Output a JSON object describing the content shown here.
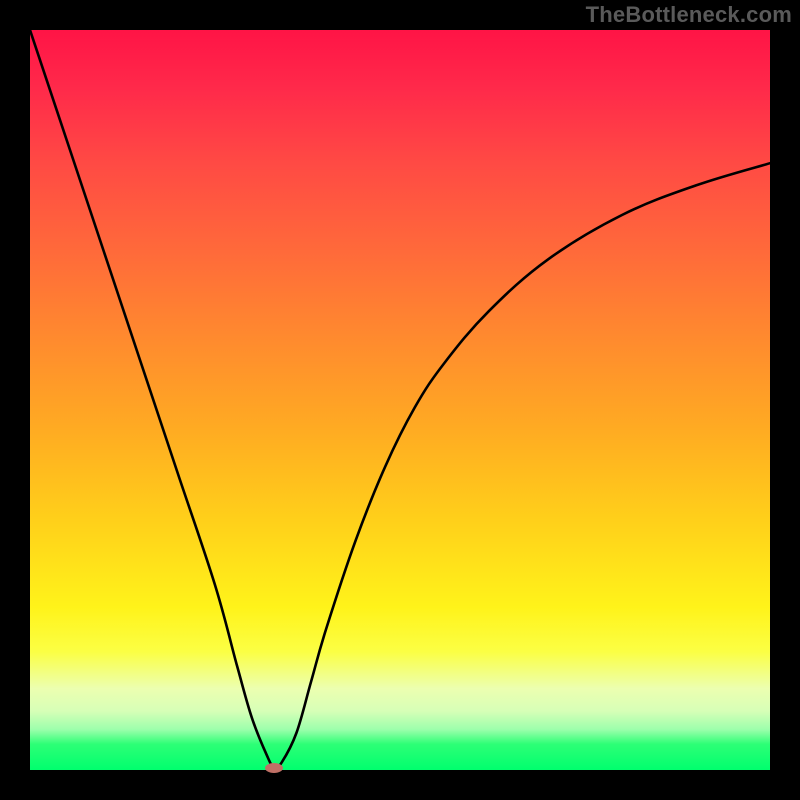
{
  "watermark": "TheBottleneck.com",
  "chart_data": {
    "type": "line",
    "title": "",
    "xlabel": "",
    "ylabel": "",
    "xlim": [
      0,
      100
    ],
    "ylim": [
      0,
      100
    ],
    "grid": false,
    "legend": false,
    "background_gradient_colors": {
      "top": "#ff1446",
      "mid": "#fff31a",
      "bottom": "#00ff6e"
    },
    "series": [
      {
        "name": "bottleneck-curve",
        "x": [
          0,
          5,
          10,
          15,
          20,
          25,
          28,
          30,
          32,
          33,
          34,
          36,
          38,
          40,
          44,
          48,
          52,
          56,
          62,
          70,
          80,
          90,
          100
        ],
        "y": [
          100,
          85,
          70,
          55,
          40,
          25,
          14,
          7,
          2,
          0.3,
          1,
          5,
          12,
          19,
          31,
          41,
          49,
          55,
          62,
          69,
          75,
          79,
          82
        ]
      }
    ],
    "marker": {
      "x": 33,
      "y": 0.3,
      "color": "#c07066"
    }
  }
}
